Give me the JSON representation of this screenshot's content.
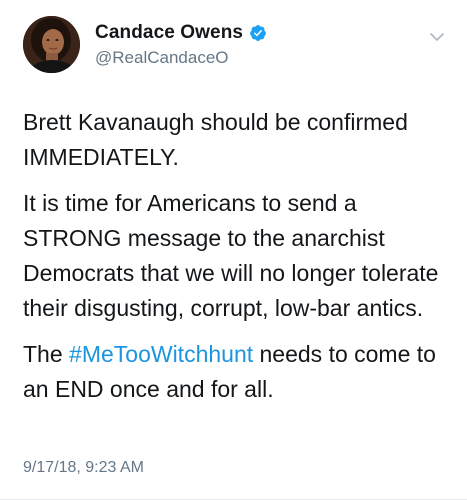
{
  "author": {
    "display_name": "Candace Owens",
    "handle": "@RealCandaceO",
    "verified": true
  },
  "icons": {
    "verified": "verified-badge-icon",
    "menu": "chevron-down-icon"
  },
  "colors": {
    "link": "#1b95e0",
    "verified": "#1da1f2",
    "secondary_text": "#657786"
  },
  "tweet": {
    "paragraph_1": "Brett Kavanaugh should be confirmed IMMEDIATELY.",
    "paragraph_2": "It is time for Americans to send a STRONG message to the anarchist Democrats that we will no longer tolerate their disgusting, corrupt, low-bar antics.",
    "paragraph_3_prefix": "The ",
    "hashtag": "#MeTooWitchhunt",
    "paragraph_3_suffix": " needs to come to an END once and for all.",
    "timestamp": "9/17/18, 9:23 AM"
  }
}
